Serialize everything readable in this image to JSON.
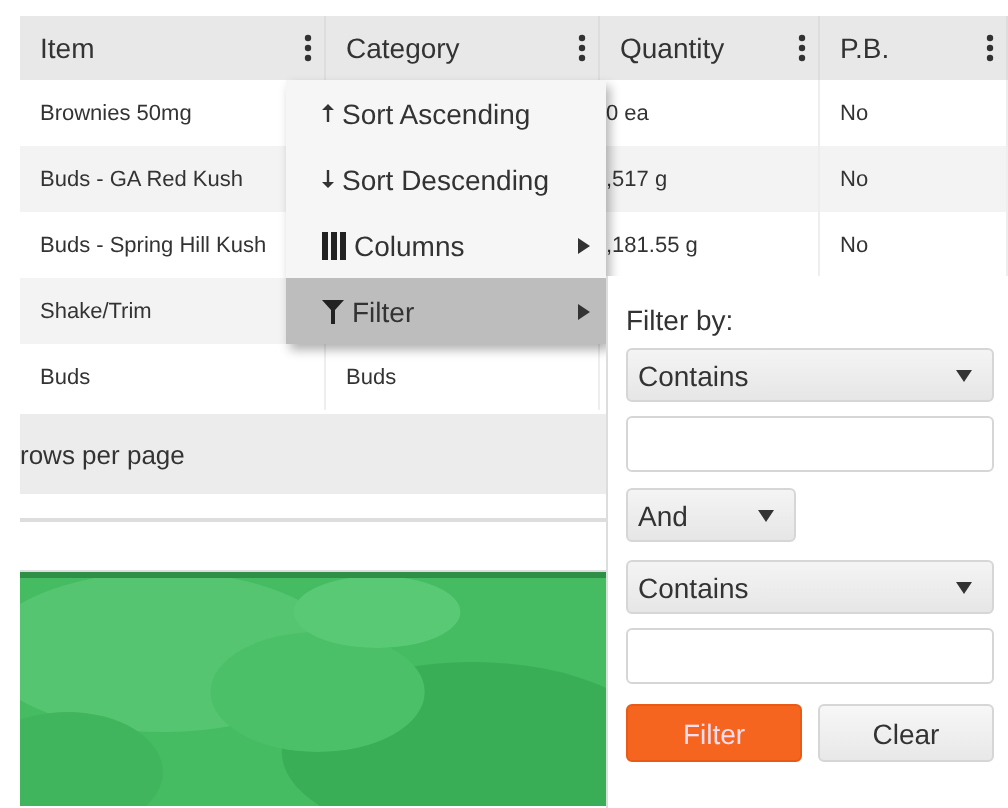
{
  "columns": [
    {
      "label": "Item"
    },
    {
      "label": "Category"
    },
    {
      "label": "Quantity"
    },
    {
      "label": "P.B."
    }
  ],
  "rows": [
    {
      "item": "Brownies 50mg",
      "quantity": "0 ea",
      "pb": "No"
    },
    {
      "item": "Buds - GA Red Kush",
      "quantity": ",517 g",
      "pb": "No"
    },
    {
      "item": "Buds - Spring Hill Kush",
      "quantity": ",181.55 g",
      "pb": "No"
    },
    {
      "item": "Shake/Trim"
    },
    {
      "item": "Buds",
      "category": "Buds"
    }
  ],
  "pager": {
    "label": "rows per page"
  },
  "column_menu": [
    {
      "kind": "sort-asc",
      "label": "Sort Ascending",
      "submenu": false,
      "selected": false
    },
    {
      "kind": "sort-desc",
      "label": "Sort Descending",
      "submenu": false,
      "selected": false
    },
    {
      "kind": "columns",
      "label": "Columns",
      "submenu": true,
      "selected": false
    },
    {
      "kind": "filter",
      "label": "Filter",
      "submenu": true,
      "selected": true
    }
  ],
  "filter_panel": {
    "title": "Filter by:",
    "operator_1": "Contains",
    "logic": "And",
    "operator_2": "Contains",
    "buttons": [
      {
        "label": "Filter",
        "kind": "primary"
      },
      {
        "label": "Clear",
        "kind": "secondary"
      }
    ]
  }
}
